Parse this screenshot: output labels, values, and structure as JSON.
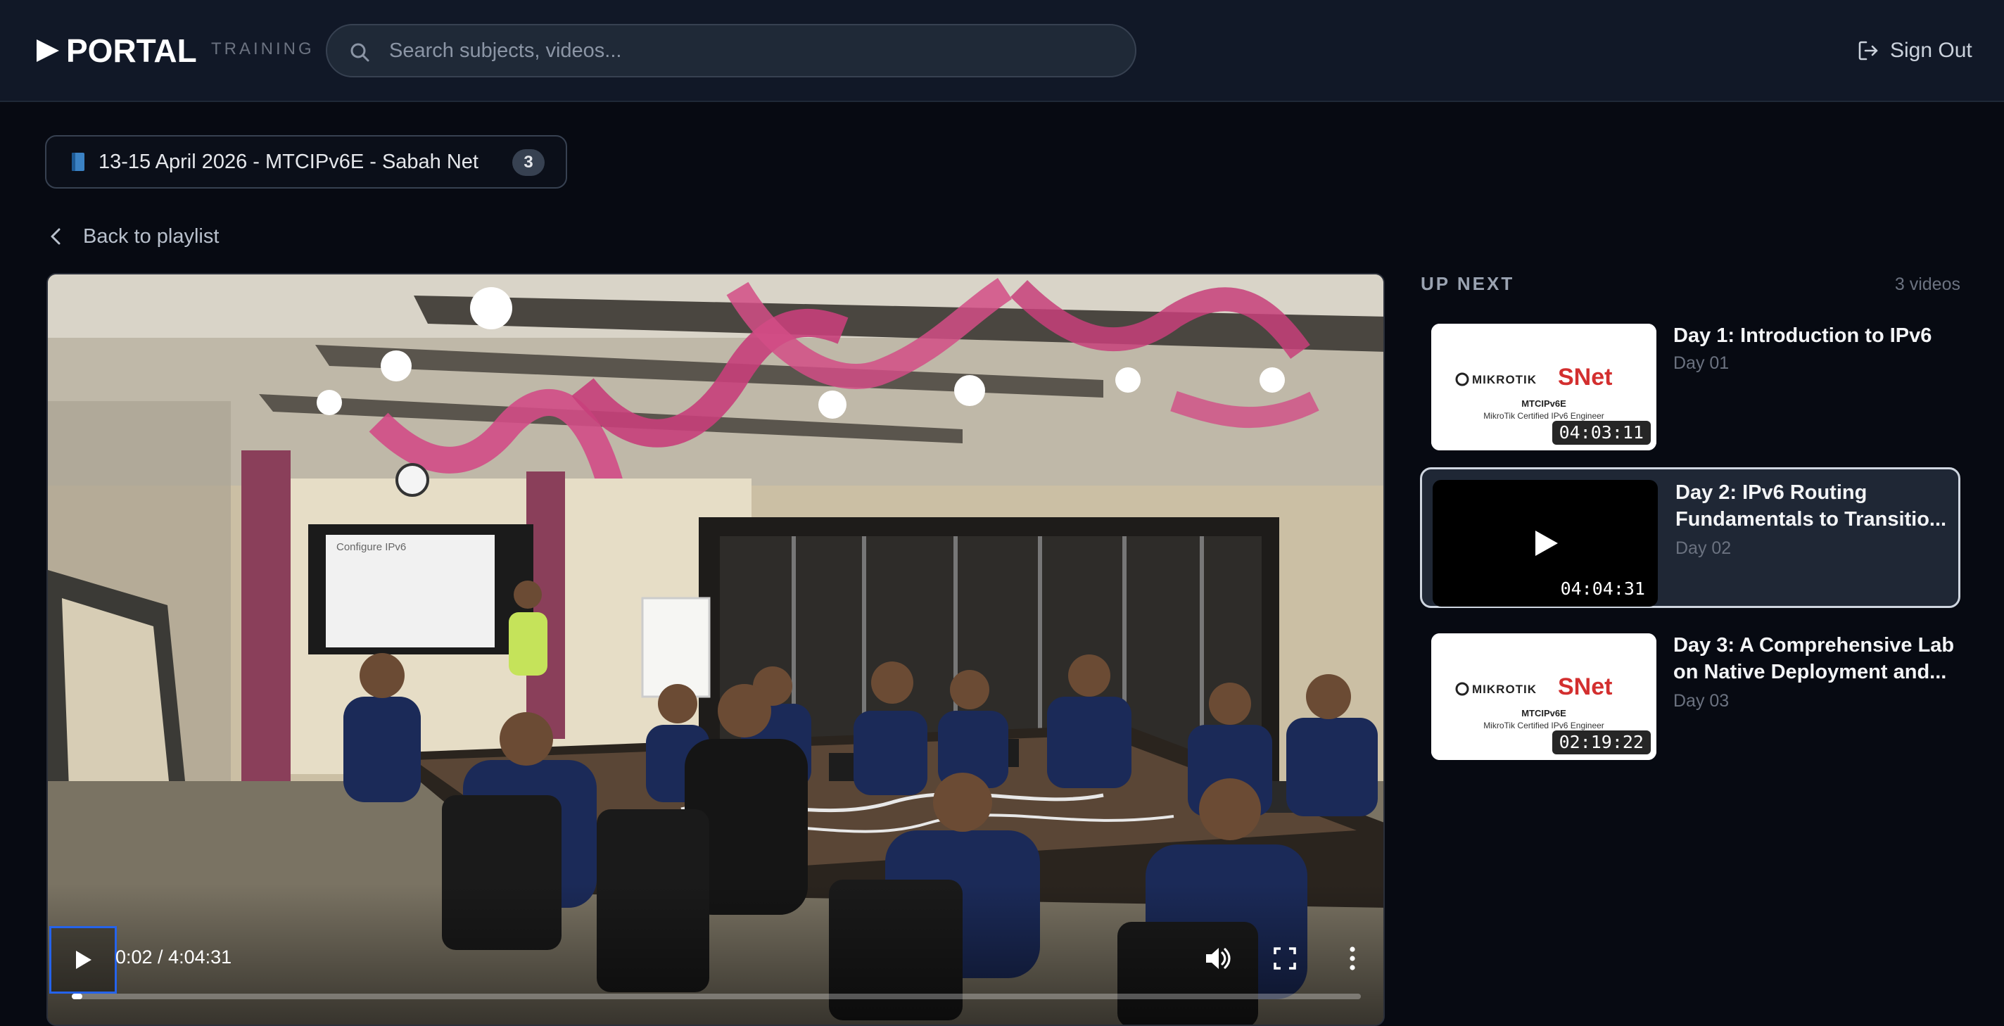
{
  "header": {
    "logo_text": "PORTAL",
    "logo_sub": "TRAINING",
    "search_placeholder": "Search subjects, videos...",
    "signout_label": "Sign Out"
  },
  "playlist_chip": {
    "label": "13-15 April 2026 - MTCIPv6E - Sabah Net",
    "count": "3"
  },
  "back_link": "Back to playlist",
  "player": {
    "time_display": "0:02 / 4:04:31",
    "progress_fraction": 0.008,
    "slide_title": "Configure IPv6"
  },
  "up_next": {
    "title": "UP NEXT",
    "count_label": "3 videos",
    "items": [
      {
        "title": "Day 1: Introduction to IPv6",
        "subtitle": "Day 01",
        "duration": "04:03:11",
        "thumb_type": "brand",
        "brand_left": "MIKROTIK",
        "brand_right": "SNet",
        "brand_line1": "MTCIPv6E",
        "brand_line2": "MikroTik Certified IPv6 Engineer"
      },
      {
        "title": "Day 2: IPv6 Routing Fundamentals to Transitio...",
        "subtitle": "Day 02",
        "duration": "04:04:31",
        "thumb_type": "playing"
      },
      {
        "title": "Day 3: A Comprehensive Lab on Native Deployment and...",
        "subtitle": "Day 03",
        "duration": "02:19:22",
        "thumb_type": "brand",
        "brand_left": "MIKROTIK",
        "brand_right": "SNet",
        "brand_line1": "MTCIPv6E",
        "brand_line2": "MikroTik Certified IPv6 Engineer"
      }
    ]
  },
  "colors": {
    "background": "#070a12",
    "header": "#111827",
    "accent_focus": "#2563eb",
    "brand_red": "#d32f2f"
  }
}
